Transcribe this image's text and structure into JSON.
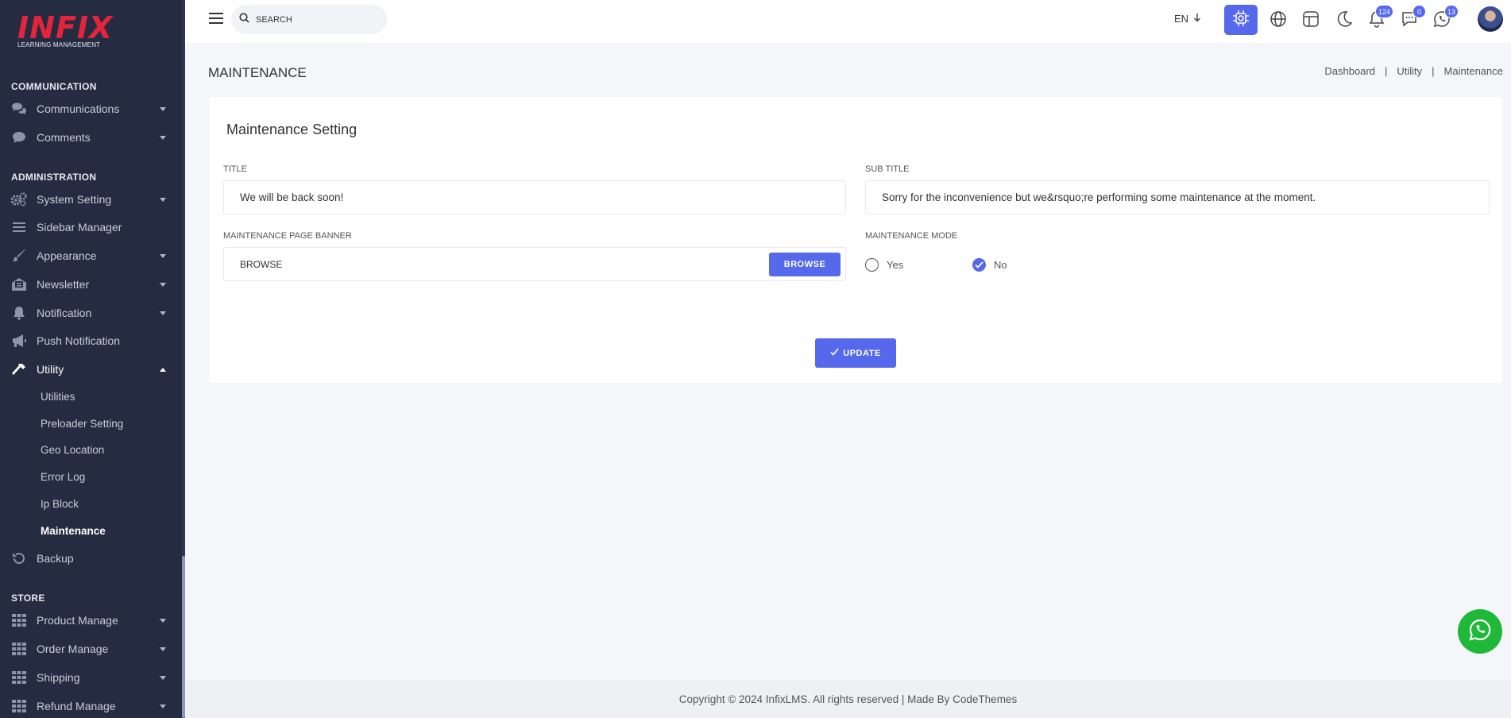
{
  "logo": {
    "main": "INFIX",
    "sub": "LEARNING MANAGEMENT"
  },
  "sidebar": {
    "sections": [
      {
        "title": "COMMUNICATION"
      },
      {
        "title": "ADMINISTRATION"
      },
      {
        "title": "STORE"
      }
    ],
    "items": [
      {
        "label": "Communications",
        "icon": "chat-icon"
      },
      {
        "label": "Comments",
        "icon": "comment-icon"
      },
      {
        "label": "System Setting",
        "icon": "gears-icon"
      },
      {
        "label": "Sidebar Manager",
        "icon": "bars-icon"
      },
      {
        "label": "Appearance",
        "icon": "brush-icon"
      },
      {
        "label": "Newsletter",
        "icon": "newsletter-icon"
      },
      {
        "label": "Notification",
        "icon": "bell-icon"
      },
      {
        "label": "Push Notification",
        "icon": "megaphone-icon"
      },
      {
        "label": "Utility",
        "icon": "hammer-icon"
      },
      {
        "label": "Backup",
        "icon": "backup-icon"
      },
      {
        "label": "Product Manage",
        "icon": "grid-icon"
      },
      {
        "label": "Order Manage",
        "icon": "grid-icon"
      },
      {
        "label": "Shipping",
        "icon": "grid-icon"
      },
      {
        "label": "Refund Manage",
        "icon": "grid-icon"
      }
    ],
    "utility_sub": [
      "Utilities",
      "Preloader Setting",
      "Geo Location",
      "Error Log",
      "Ip Block",
      "Maintenance"
    ]
  },
  "header": {
    "search_placeholder": "SEARCH",
    "lang": "EN",
    "badges": {
      "notifications": "124",
      "messages": "0",
      "whatsapp": "13"
    }
  },
  "page": {
    "title": "MAINTENANCE",
    "breadcrumb": [
      "Dashboard",
      "Utility",
      "Maintenance"
    ]
  },
  "form": {
    "card_title": "Maintenance Setting",
    "title_label": "TITLE",
    "title_value": "We will be back soon!",
    "subtitle_label": "SUB TITLE",
    "subtitle_value": "Sorry for the inconvenience but we&rsquo;re performing some maintenance at the moment.",
    "banner_label": "MAINTENANCE PAGE BANNER",
    "banner_value": "BROWSE",
    "browse_button": "BROWSE",
    "mode_label": "MAINTENANCE MODE",
    "mode_yes": "Yes",
    "mode_no": "No",
    "mode_selected": "No",
    "update_button": "UPDATE"
  },
  "footer": {
    "text": "Copyright © 2024 InfixLMS. All rights reserved | Made By CodeThemes"
  },
  "colors": {
    "accent": "#5669ec",
    "sidebar_bg": "#252c41",
    "logo_red": "#e3243b",
    "whatsapp": "#1fb838"
  }
}
